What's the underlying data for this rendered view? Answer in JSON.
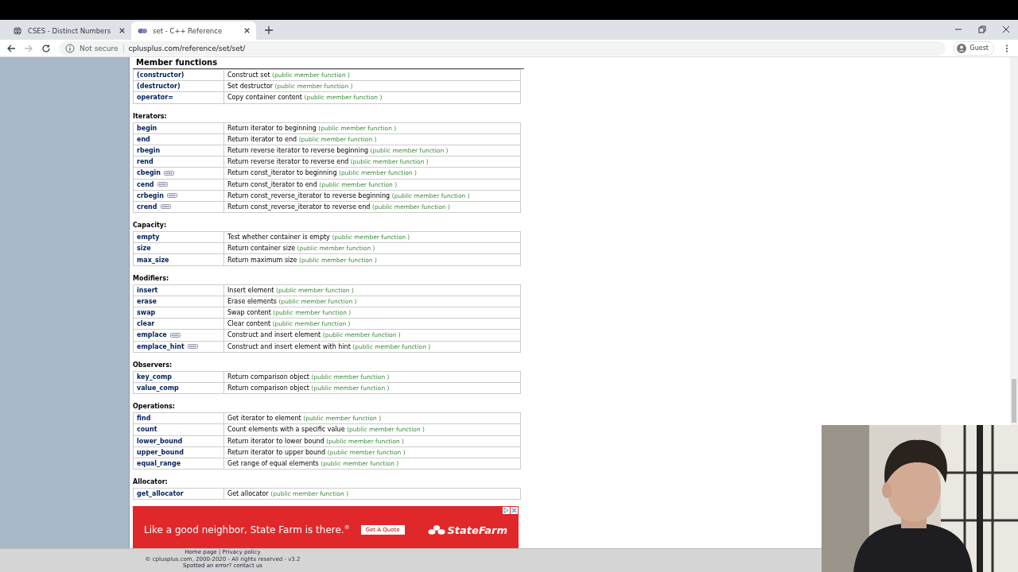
{
  "tabs": [
    {
      "title": "CSES - Distinct Numbers",
      "selected": false
    },
    {
      "title": "set - C++ Reference",
      "selected": true
    }
  ],
  "address": {
    "security": "Not secure",
    "url": "cplusplus.com/reference/set/set/"
  },
  "profile": "Guest",
  "heading": "Member functions",
  "groups": [
    {
      "rows": [
        {
          "name": "(constructor)",
          "description": "Construct set",
          "type": "(public member function )",
          "cpp11": false
        },
        {
          "name": "(destructor)",
          "description": "Set destructor",
          "type": "(public member function )",
          "cpp11": false
        },
        {
          "name": "operator=",
          "description": "Copy container content",
          "type": "(public member function )",
          "cpp11": false
        }
      ]
    },
    {
      "label": "Iterators:",
      "rows": [
        {
          "name": "begin",
          "description": "Return iterator to beginning",
          "type": "(public member function )",
          "cpp11": false
        },
        {
          "name": "end",
          "description": "Return iterator to end",
          "type": "(public member function )",
          "cpp11": false
        },
        {
          "name": "rbegin",
          "description": "Return reverse iterator to reverse beginning",
          "type": "(public member function )",
          "cpp11": false
        },
        {
          "name": "rend",
          "description": "Return reverse iterator to reverse end",
          "type": "(public member function )",
          "cpp11": false
        },
        {
          "name": "cbegin",
          "description": "Return const_iterator to beginning",
          "type": "(public member function )",
          "cpp11": true
        },
        {
          "name": "cend",
          "description": "Return const_iterator to end",
          "type": "(public member function )",
          "cpp11": true
        },
        {
          "name": "crbegin",
          "description": "Return const_reverse_iterator to reverse beginning",
          "type": "(public member function )",
          "cpp11": true
        },
        {
          "name": "crend",
          "description": "Return const_reverse_iterator to reverse end",
          "type": "(public member function )",
          "cpp11": true
        }
      ]
    },
    {
      "label": "Capacity:",
      "rows": [
        {
          "name": "empty",
          "description": "Test whether container is empty",
          "type": "(public member function )",
          "cpp11": false
        },
        {
          "name": "size",
          "description": "Return container size",
          "type": "(public member function )",
          "cpp11": false
        },
        {
          "name": "max_size",
          "description": "Return maximum size",
          "type": "(public member function )",
          "cpp11": false
        }
      ]
    },
    {
      "label": "Modifiers:",
      "rows": [
        {
          "name": "insert",
          "description": "Insert element",
          "type": "(public member function )",
          "cpp11": false
        },
        {
          "name": "erase",
          "description": "Erase elements",
          "type": "(public member function )",
          "cpp11": false
        },
        {
          "name": "swap",
          "description": "Swap content",
          "type": "(public member function )",
          "cpp11": false
        },
        {
          "name": "clear",
          "description": "Clear content",
          "type": "(public member function )",
          "cpp11": false
        },
        {
          "name": "emplace",
          "description": "Construct and insert element",
          "type": "(public member function )",
          "cpp11": true
        },
        {
          "name": "emplace_hint",
          "description": "Construct and insert element with hint",
          "type": "(public member function )",
          "cpp11": true
        }
      ]
    },
    {
      "label": "Observers:",
      "rows": [
        {
          "name": "key_comp",
          "description": "Return comparison object",
          "type": "(public member function )",
          "cpp11": false
        },
        {
          "name": "value_comp",
          "description": "Return comparison object",
          "type": "(public member function )",
          "cpp11": false
        }
      ]
    },
    {
      "label": "Operations:",
      "rows": [
        {
          "name": "find",
          "description": "Get iterator to element",
          "type": "(public member function )",
          "cpp11": false
        },
        {
          "name": "count",
          "description": "Count elements with a specific value",
          "type": "(public member function )",
          "cpp11": false
        },
        {
          "name": "lower_bound",
          "description": "Return iterator to lower bound",
          "type": "(public member function )",
          "cpp11": false
        },
        {
          "name": "upper_bound",
          "description": "Return iterator to upper bound",
          "type": "(public member function )",
          "cpp11": false
        },
        {
          "name": "equal_range",
          "description": "Get range of equal elements",
          "type": "(public member function )",
          "cpp11": false
        }
      ]
    },
    {
      "label": "Allocator:",
      "rows": [
        {
          "name": "get_allocator",
          "description": "Get allocator",
          "type": "(public member function )",
          "cpp11": false
        }
      ]
    }
  ],
  "ad": {
    "slogan": "Like a good neighbor, State Farm is there.$^{®}$",
    "button": "Get A Quote",
    "brand": "StateFarm"
  },
  "footer": {
    "links": [
      "Home page",
      "Privacy policy"
    ],
    "separator": "|",
    "copyright": "© cplusplus.com, 2000-2020 - All rights reserved - v3.2",
    "error_link": "Spotted an error? contact us"
  }
}
